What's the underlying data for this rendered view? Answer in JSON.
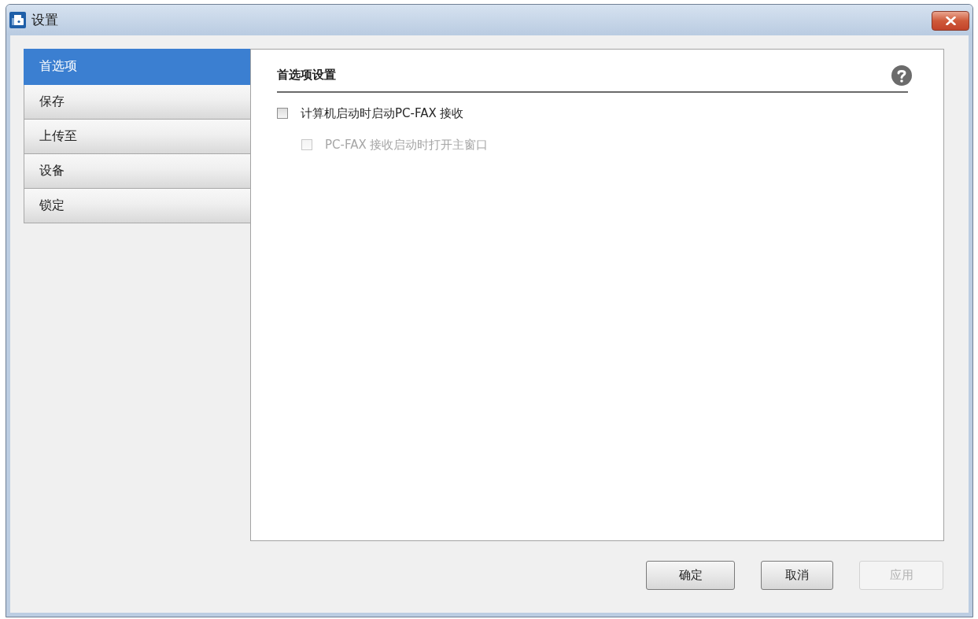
{
  "window": {
    "title": "设置"
  },
  "sidebar": {
    "items": [
      {
        "label": "首选项",
        "selected": true
      },
      {
        "label": "保存",
        "selected": false
      },
      {
        "label": "上传至",
        "selected": false
      },
      {
        "label": "设备",
        "selected": false
      },
      {
        "label": "锁定",
        "selected": false
      }
    ]
  },
  "panel": {
    "heading": "首选项设置",
    "options": [
      {
        "label": "计算机启动时启动PC-FAX 接收",
        "checked": false,
        "disabled": false,
        "children": [
          {
            "label": "PC-FAX 接收启动时打开主窗口",
            "checked": false,
            "disabled": true
          }
        ]
      }
    ]
  },
  "buttons": [
    {
      "label": "确定",
      "disabled": false
    },
    {
      "label": "取消",
      "disabled": false
    },
    {
      "label": "应用",
      "disabled": true
    }
  ]
}
